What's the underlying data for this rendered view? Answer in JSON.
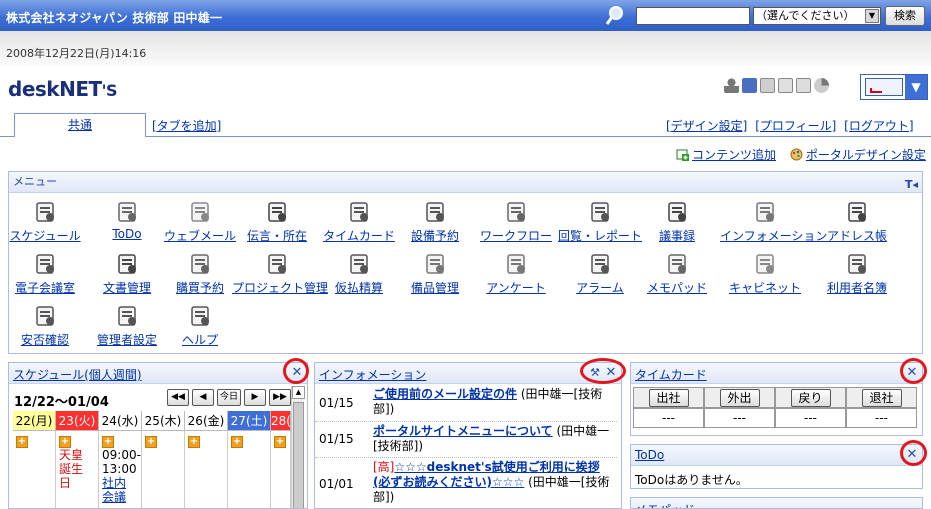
{
  "header": {
    "title": "株式会社ネオジャパン 技術部 田中雄一",
    "search_placeholder": "",
    "search_select": "（選んでください）",
    "search_button": "検索"
  },
  "date_text": "2008年12月22日(月)14:16",
  "logo": {
    "text": "deskNET",
    "suffix": "'S"
  },
  "tabs": {
    "common": "共通",
    "add": "[タブを追加]"
  },
  "top_links": [
    "[デザイン設定]",
    "[プロフィール]",
    "[ログアウト]"
  ],
  "content_links": {
    "add_content": "コンテンツ追加",
    "portal_design": "ポータルデザイン設定"
  },
  "menu": {
    "title": "メニュー",
    "pin": "T",
    "items": [
      "スケジュール",
      "ToDo",
      "ウェブメール",
      "伝言・所在",
      "タイムカード",
      "設備予約",
      "ワークフロー",
      "回覧・レポート",
      "議事録",
      "インフォメーション",
      "アドレス帳",
      "電子会議室",
      "文書管理",
      "購買予約",
      "プロジェクト管理",
      "仮払精算",
      "備品管理",
      "アンケート",
      "アラーム",
      "メモパッド",
      "キャビネット",
      "利用者名簿",
      "安否確認",
      "管理者設定",
      "ヘルプ"
    ]
  },
  "schedule": {
    "title": "スケジュール(個人週間)",
    "range": "12/22～01/04",
    "nav": [
      "◀◀",
      "◀",
      "今日",
      "▶",
      "▶▶"
    ],
    "days": [
      {
        "label": "22(月)",
        "color": "#ffff99",
        "text": "#000000"
      },
      {
        "label": "23(火)",
        "color": "#ff3030",
        "text": "#ffffff"
      },
      {
        "label": "24(水)",
        "color": "#ffffff",
        "text": "#000000"
      },
      {
        "label": "25(木)",
        "color": "#ffffff",
        "text": "#000000"
      },
      {
        "label": "26(金)",
        "color": "#ffffff",
        "text": "#000000"
      },
      {
        "label": "27(土)",
        "color": "#3d6fd6",
        "text": "#ffffff"
      },
      {
        "label": "28(",
        "color": "#ff3030",
        "text": "#ffffff"
      }
    ],
    "holiday_lines": [
      "天皇",
      "誕生",
      "日"
    ],
    "event_time": [
      "09:00-",
      "13:00"
    ],
    "event_title": [
      "社内",
      "会議"
    ]
  },
  "info": {
    "title": "インフォメーション",
    "rows": [
      {
        "date": "01/15",
        "title": "ご使用前のメール設定の件",
        "author": "(田中雄一[技術部])",
        "flag": ""
      },
      {
        "date": "01/15",
        "title": "ポータルサイトメニューについて",
        "author": "(田中雄一[技術部])",
        "flag": ""
      },
      {
        "date": "01/01",
        "title": "☆☆☆desknet's試使用ご利用に挨拶(必ずお読みください)☆☆☆",
        "author": "(田中雄一[技術部])",
        "flag": "[高]"
      }
    ]
  },
  "timecard": {
    "title": "タイムカード",
    "buttons": [
      "出社",
      "外出",
      "戻り",
      "退社"
    ],
    "values": [
      "---",
      "---",
      "---",
      "---"
    ]
  },
  "todo": {
    "title": "ToDo",
    "empty": "ToDoはありません。"
  },
  "memo": {
    "title": "メモパッド"
  },
  "colors": {
    "accent": "#3d6fd6",
    "link": "#0033aa",
    "highlight": "#e5151d"
  }
}
